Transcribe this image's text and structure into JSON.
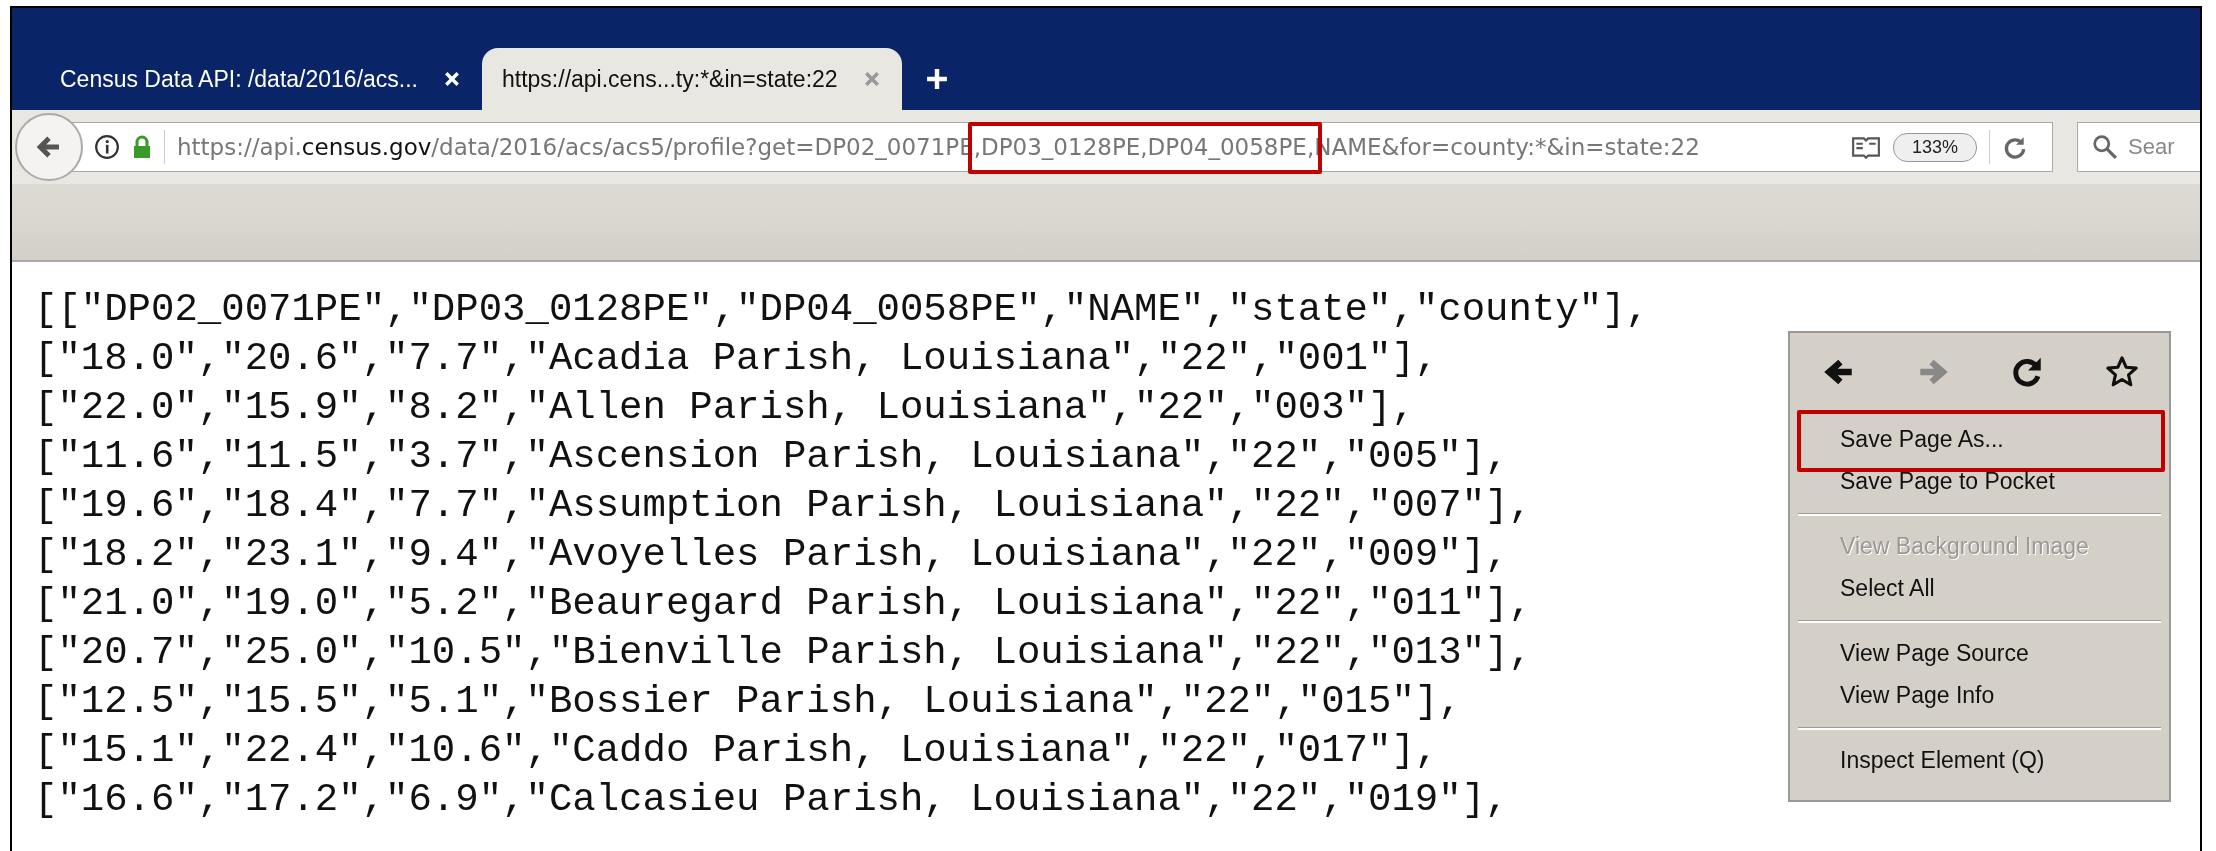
{
  "tabs": [
    {
      "title": "Census Data API: /data/2016/acs...",
      "selected": false
    },
    {
      "title": "https://api.cens...ty:*&in=state:22",
      "selected": true
    }
  ],
  "address_bar": {
    "url_prefix": "https://api.",
    "url_host": "census.gov",
    "url_path": "/data/2016/acs/acs5/profile?get=DP02_0071PE",
    "url_marked": ",DP03_0128PE,DP04_0058PE,",
    "url_rest": "NAME&for=county:*&in=state:22",
    "zoom": "133%"
  },
  "search": {
    "placeholder": "Sear"
  },
  "content_lines": [
    "[[\"DP02_0071PE\",\"DP03_0128PE\",\"DP04_0058PE\",\"NAME\",\"state\",\"county\"],",
    "[\"18.0\",\"20.6\",\"7.7\",\"Acadia Parish, Louisiana\",\"22\",\"001\"],",
    "[\"22.0\",\"15.9\",\"8.2\",\"Allen Parish, Louisiana\",\"22\",\"003\"],",
    "[\"11.6\",\"11.5\",\"3.7\",\"Ascension Parish, Louisiana\",\"22\",\"005\"],",
    "[\"19.6\",\"18.4\",\"7.7\",\"Assumption Parish, Louisiana\",\"22\",\"007\"],",
    "[\"18.2\",\"23.1\",\"9.4\",\"Avoyelles Parish, Louisiana\",\"22\",\"009\"],",
    "[\"21.0\",\"19.0\",\"5.2\",\"Beauregard Parish, Louisiana\",\"22\",\"011\"],",
    "[\"20.7\",\"25.0\",\"10.5\",\"Bienville Parish, Louisiana\",\"22\",\"013\"],",
    "[\"12.5\",\"15.5\",\"5.1\",\"Bossier Parish, Louisiana\",\"22\",\"015\"],",
    "[\"15.1\",\"22.4\",\"10.6\",\"Caddo Parish, Louisiana\",\"22\",\"017\"],",
    "[\"16.6\",\"17.2\",\"6.9\",\"Calcasieu Parish, Louisiana\",\"22\",\"019\"],"
  ],
  "context_menu": {
    "nav_buttons": [
      {
        "kind": "back",
        "disabled": false
      },
      {
        "kind": "forward",
        "disabled": true
      },
      {
        "kind": "reload",
        "disabled": false
      },
      {
        "kind": "bookmark",
        "disabled": false
      }
    ],
    "items": [
      {
        "kind": "item",
        "label": "Save Page As...",
        "disabled": false,
        "highlighted": true
      },
      {
        "kind": "item",
        "label": "Save Page to Pocket",
        "disabled": false,
        "highlighted": false
      },
      {
        "kind": "separator"
      },
      {
        "kind": "item",
        "label": "View Background Image",
        "disabled": true,
        "highlighted": false
      },
      {
        "kind": "item",
        "label": "Select All",
        "disabled": false,
        "highlighted": false
      },
      {
        "kind": "separator"
      },
      {
        "kind": "item",
        "label": "View Page Source",
        "disabled": false,
        "highlighted": false
      },
      {
        "kind": "item",
        "label": "View Page Info",
        "disabled": false,
        "highlighted": false
      },
      {
        "kind": "separator"
      },
      {
        "kind": "item",
        "label": "Inspect Element (Q)",
        "disabled": false,
        "highlighted": false
      }
    ]
  }
}
